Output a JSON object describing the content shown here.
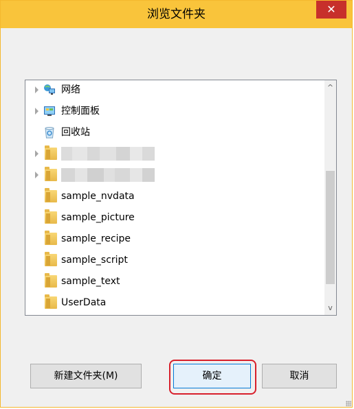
{
  "dialog": {
    "title": "浏览文件夹",
    "close_symbol": "✕"
  },
  "tree": {
    "items": [
      {
        "label": "网络",
        "icon": "network-icon",
        "expandable": true
      },
      {
        "label": "控制面板",
        "icon": "control-panel-icon",
        "expandable": true
      },
      {
        "label": "回收站",
        "icon": "recycle-bin-icon",
        "expandable": false
      },
      {
        "label": "",
        "icon": "folder-icon",
        "expandable": true,
        "redacted": true
      },
      {
        "label": "",
        "icon": "folder-icon",
        "expandable": true,
        "redacted": true
      },
      {
        "label": "sample_nvdata",
        "icon": "folder-icon",
        "expandable": false
      },
      {
        "label": "sample_picture",
        "icon": "folder-icon",
        "expandable": false
      },
      {
        "label": "sample_recipe",
        "icon": "folder-icon",
        "expandable": false
      },
      {
        "label": "sample_script",
        "icon": "folder-icon",
        "expandable": false
      },
      {
        "label": "sample_text",
        "icon": "folder-icon",
        "expandable": false
      },
      {
        "label": "UserData",
        "icon": "folder-icon",
        "expandable": false
      }
    ]
  },
  "scrollbar": {
    "up_symbol": "^",
    "down_symbol": "v"
  },
  "buttons": {
    "new_folder": "新建文件夹(M)",
    "ok": "确定",
    "cancel": "取消"
  },
  "colors": {
    "titlebar": "#f9c43b",
    "close": "#c7302b",
    "highlight": "#d81e2a"
  }
}
